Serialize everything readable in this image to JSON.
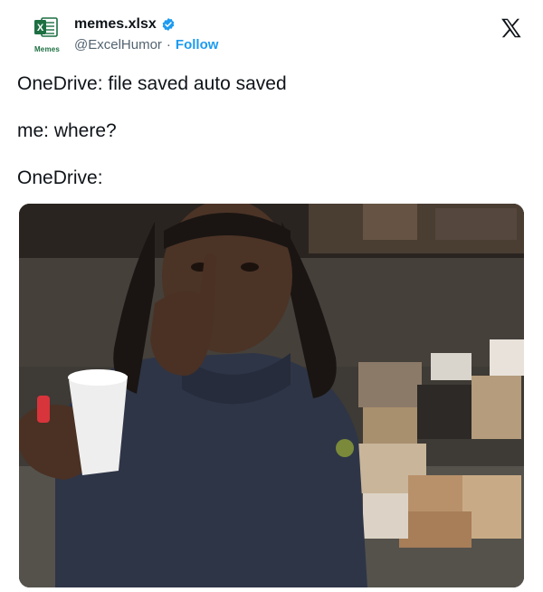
{
  "account": {
    "display_name": "memes.xlsx",
    "handle": "@ExcelHumor",
    "separator": "·",
    "follow_label": "Follow",
    "avatar_tag": "Memes",
    "avatar_letter": "X"
  },
  "tweet": {
    "lines": [
      "OneDrive: file saved auto saved",
      "me: where?",
      "OneDrive:"
    ]
  },
  "media": {
    "description_icon": "photo"
  },
  "icons": {
    "platform": "x-logo-icon",
    "verified": "verified-badge-icon"
  },
  "colors": {
    "accent": "#1d9bf0",
    "excel_green": "#1d6f42",
    "text": "#0f1419",
    "secondary": "#536471"
  }
}
